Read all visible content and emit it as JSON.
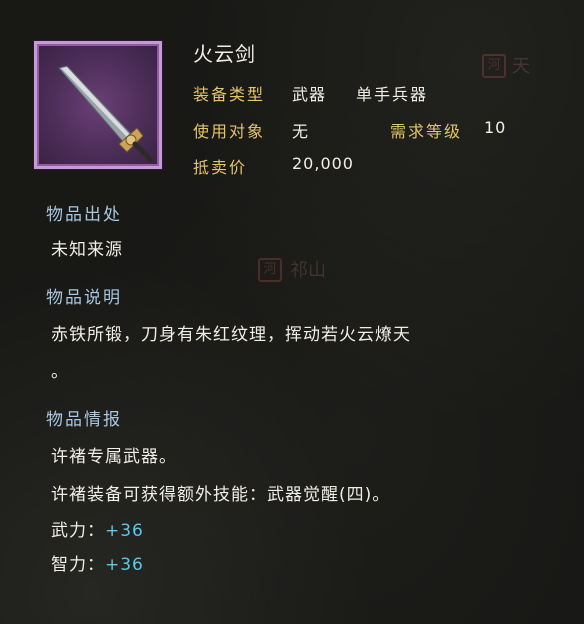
{
  "item": {
    "name": "火云剑",
    "type_label": "装备类型",
    "type_value": "武器",
    "subtype_value": "单手兵器",
    "target_label": "使用对象",
    "target_value": "无",
    "level_label": "需求等级",
    "level_value": "10",
    "price_label": "抵卖价",
    "price_value": "20,000",
    "icon": "sword-icon"
  },
  "sections": {
    "origin_title": "物品出处",
    "origin_text": "未知来源",
    "desc_title": "物品说明",
    "desc_line1": "赤铁所锻，刀身有朱红纹理，挥动若火云燎天",
    "desc_line2": "。",
    "info_title": "物品情报",
    "info_line1": "许褚专属武器。",
    "info_line2": "许褚装备可获得额外技能：武器觉醒(四)。",
    "stat1_label": "武力：",
    "stat1_value": "+36",
    "stat2_label": "智力：",
    "stat2_value": "+36"
  },
  "background": {
    "map_text1": "天",
    "map_text2": "祁山",
    "seal1": "河",
    "seal2": "河"
  },
  "colors": {
    "label": "#e4c56a",
    "section": "#a9c7e0",
    "bonus": "#5ec7ea",
    "frame": "#c69ad6"
  }
}
